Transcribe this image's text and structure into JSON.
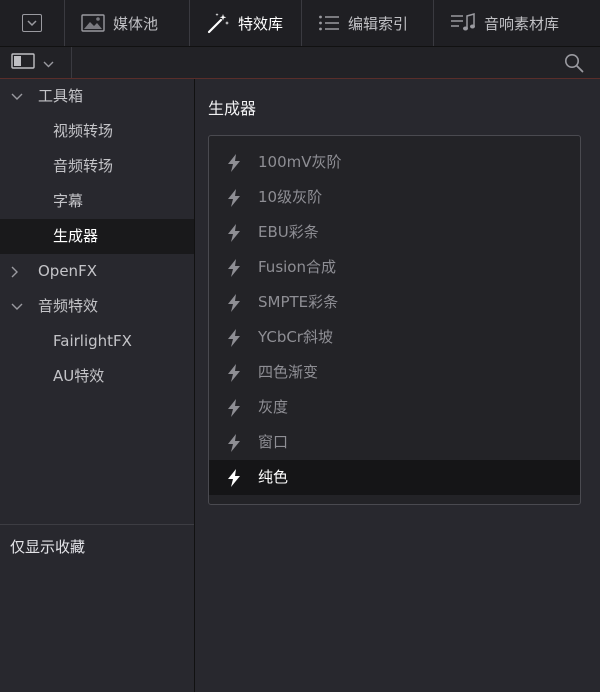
{
  "tabs": [
    {
      "label": "媒体池",
      "icon": "image-icon",
      "active": false
    },
    {
      "label": "特效库",
      "icon": "magic-wand-icon",
      "active": true
    },
    {
      "label": "编辑索引",
      "icon": "list-icon",
      "active": false
    },
    {
      "label": "音响素材库",
      "icon": "music-list-icon",
      "active": false
    }
  ],
  "tree": [
    {
      "label": "工具箱",
      "chevron": "down",
      "indent": 1
    },
    {
      "label": "视频转场",
      "chevron": "",
      "indent": 2
    },
    {
      "label": "音频转场",
      "chevron": "",
      "indent": 2
    },
    {
      "label": "字幕",
      "chevron": "",
      "indent": 2
    },
    {
      "label": "生成器",
      "chevron": "",
      "indent": 2,
      "selected": true
    },
    {
      "label": "OpenFX",
      "chevron": "right",
      "indent": 1
    },
    {
      "label": "音频特效",
      "chevron": "down",
      "indent": 1
    },
    {
      "label": "FairlightFX",
      "chevron": "",
      "indent": 2
    },
    {
      "label": "AU特效",
      "chevron": "",
      "indent": 2
    }
  ],
  "favorites_only_label": "仅显示收藏",
  "section_title": "生成器",
  "generators": [
    {
      "label": "100mV灰阶"
    },
    {
      "label": "10级灰阶"
    },
    {
      "label": "EBU彩条"
    },
    {
      "label": "Fusion合成"
    },
    {
      "label": "SMPTE彩条"
    },
    {
      "label": "YCbCr斜坡"
    },
    {
      "label": "四色渐变"
    },
    {
      "label": "灰度"
    },
    {
      "label": "窗口"
    },
    {
      "label": "纯色",
      "selected": true
    }
  ],
  "colors": {
    "accent_line": "#5a2e2a",
    "selected_bg": "#151517"
  }
}
